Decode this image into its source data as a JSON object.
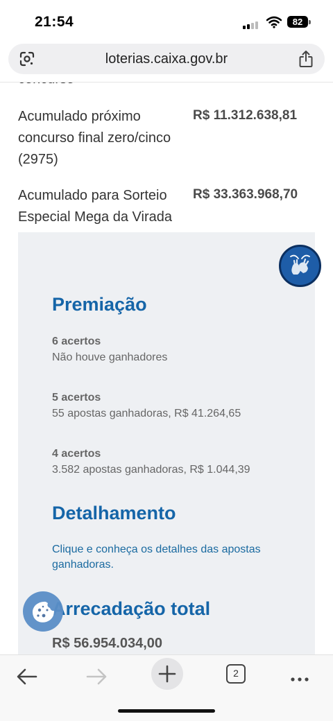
{
  "status_bar": {
    "time": "21:54",
    "battery": "82",
    "icons": [
      "signal-icon",
      "wifi-icon",
      "battery-icon"
    ]
  },
  "browser": {
    "url": "loterias.caixa.gov.br",
    "tab_count": "2",
    "icons": [
      "google-lens-icon",
      "share-icon",
      "back-arrow-icon",
      "forward-arrow-icon",
      "new-tab-plus-icon",
      "tabs-icon",
      "more-menu-icon"
    ]
  },
  "page": {
    "cut_off_text": "concurso",
    "accumulated": [
      {
        "label": "Acumulado próximo concurso final zero/cinco (2975)",
        "value": "R$ 11.312.638,81"
      },
      {
        "label": "Acumulado para Sorteio Especial Mega da Virada",
        "value": "R$ 33.363.968,70"
      }
    ],
    "premiacao_title": "Premiação",
    "prizes": [
      {
        "hits": "6 acertos",
        "desc": "Não houve ganhadores"
      },
      {
        "hits": "5 acertos",
        "desc": "55 apostas ganhadoras, R$ 41.264,65"
      },
      {
        "hits": "4 acertos",
        "desc": "3.582 apostas ganhadoras, R$ 1.044,39"
      }
    ],
    "detalhamento_title": "Detalhamento",
    "detail_link": "Clique e conheça os detalhes das apostas ganhadoras.",
    "arrecadacao_title": "Arrecadação total",
    "arrecadacao_value": "R$ 56.954.034,00"
  },
  "colors": {
    "heading": "#1565a8",
    "link": "#1a6aa0",
    "panel_bg": "#eef0f3",
    "libras_button": "#1e5da8"
  }
}
